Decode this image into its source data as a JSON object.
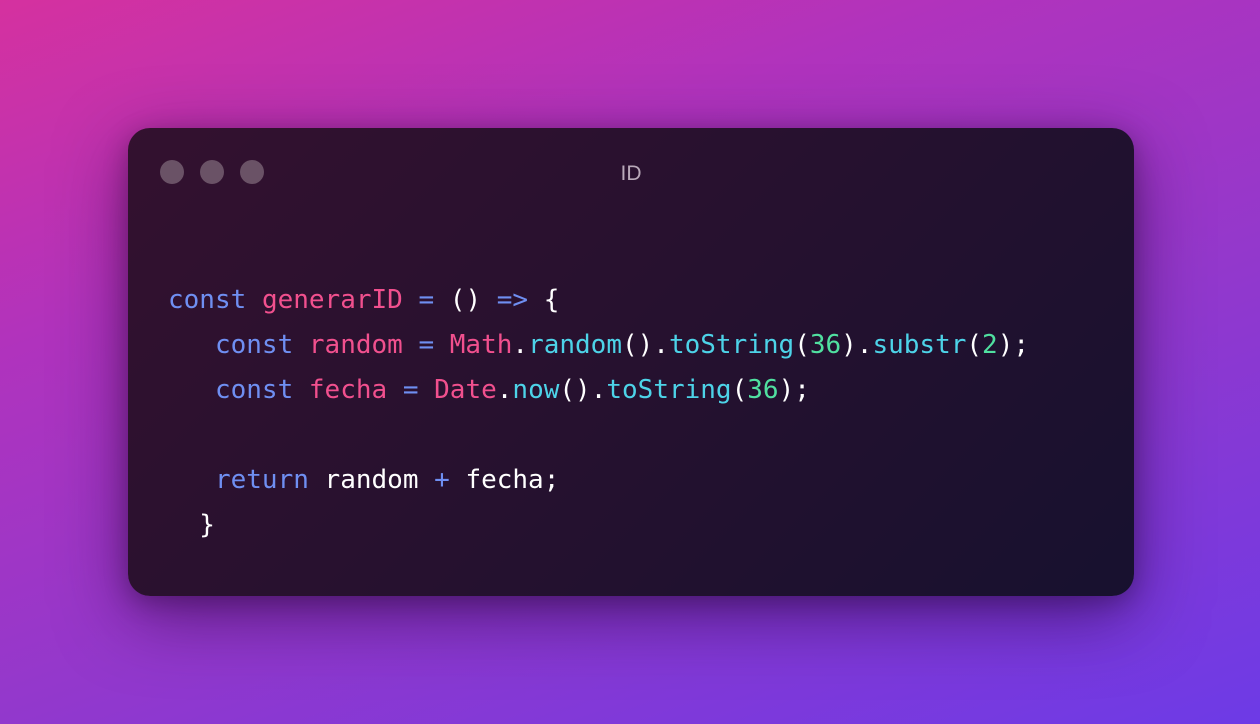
{
  "window": {
    "title": "ID",
    "controls": [
      "close-dot",
      "minimize-dot",
      "maximize-dot"
    ]
  },
  "code": {
    "language": "javascript",
    "lines": [
      [
        {
          "t": "const",
          "c": "kw"
        },
        {
          "t": " ",
          "c": "pun"
        },
        {
          "t": "generarID",
          "c": "var"
        },
        {
          "t": " ",
          "c": "pun"
        },
        {
          "t": "=",
          "c": "op"
        },
        {
          "t": " ",
          "c": "pun"
        },
        {
          "t": "()",
          "c": "pun"
        },
        {
          "t": " ",
          "c": "pun"
        },
        {
          "t": "=>",
          "c": "op"
        },
        {
          "t": " ",
          "c": "pun"
        },
        {
          "t": "{",
          "c": "pun"
        }
      ],
      [
        {
          "t": "   const",
          "c": "kw"
        },
        {
          "t": " ",
          "c": "pun"
        },
        {
          "t": "random",
          "c": "var"
        },
        {
          "t": " ",
          "c": "pun"
        },
        {
          "t": "=",
          "c": "op"
        },
        {
          "t": " ",
          "c": "pun"
        },
        {
          "t": "Math",
          "c": "var"
        },
        {
          "t": ".",
          "c": "pun"
        },
        {
          "t": "random",
          "c": "fn"
        },
        {
          "t": "().",
          "c": "pun"
        },
        {
          "t": "toString",
          "c": "fn"
        },
        {
          "t": "(",
          "c": "pun"
        },
        {
          "t": "36",
          "c": "num"
        },
        {
          "t": ").",
          "c": "pun"
        },
        {
          "t": "substr",
          "c": "fn"
        },
        {
          "t": "(",
          "c": "pun"
        },
        {
          "t": "2",
          "c": "num"
        },
        {
          "t": ");",
          "c": "pun"
        }
      ],
      [
        {
          "t": "   const",
          "c": "kw"
        },
        {
          "t": " ",
          "c": "pun"
        },
        {
          "t": "fecha",
          "c": "var"
        },
        {
          "t": " ",
          "c": "pun"
        },
        {
          "t": "=",
          "c": "op"
        },
        {
          "t": " ",
          "c": "pun"
        },
        {
          "t": "Date",
          "c": "var"
        },
        {
          "t": ".",
          "c": "pun"
        },
        {
          "t": "now",
          "c": "fn"
        },
        {
          "t": "().",
          "c": "pun"
        },
        {
          "t": "toString",
          "c": "fn"
        },
        {
          "t": "(",
          "c": "pun"
        },
        {
          "t": "36",
          "c": "num"
        },
        {
          "t": ");",
          "c": "pun"
        }
      ],
      [],
      [
        {
          "t": "   return",
          "c": "kw"
        },
        {
          "t": " ",
          "c": "pun"
        },
        {
          "t": "random",
          "c": "pun"
        },
        {
          "t": " ",
          "c": "pun"
        },
        {
          "t": "+",
          "c": "op"
        },
        {
          "t": " ",
          "c": "pun"
        },
        {
          "t": "fecha;",
          "c": "pun"
        }
      ],
      [
        {
          "t": "  }",
          "c": "pun"
        }
      ]
    ]
  },
  "colors": {
    "background_start": "#d5319f",
    "background_end": "#6d3ae6",
    "window_bg": "#26112f",
    "keyword": "#6f8ff2",
    "identifier": "#f1508e",
    "function": "#4dd3e8",
    "number": "#50e0a0",
    "plain": "#ffffff"
  }
}
